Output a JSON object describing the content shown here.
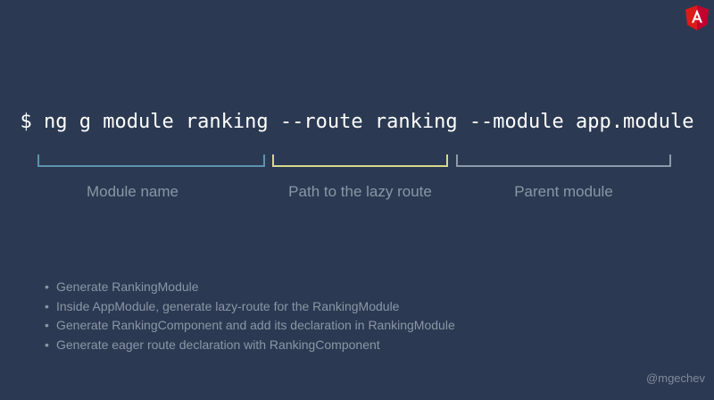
{
  "logo": {
    "icon": "angular-logo-icon",
    "color": "#dd1b16"
  },
  "command": "$ ng g module ranking --route ranking --module app.module",
  "segments": [
    {
      "label": "Module name",
      "color": "#5d92ad"
    },
    {
      "label": "Path to the lazy route",
      "color": "#d6d98a"
    },
    {
      "label": "Parent module",
      "color": "#8d9aa9"
    }
  ],
  "bullets": [
    "Generate RankingModule",
    "Inside AppModule, generate lazy-route for the RankingModule",
    "Generate RankingComponent and add its declaration in RankingModule",
    "Generate eager route declaration with RankingComponent"
  ],
  "bullet_glyph": "•",
  "handle": "@mgechev"
}
